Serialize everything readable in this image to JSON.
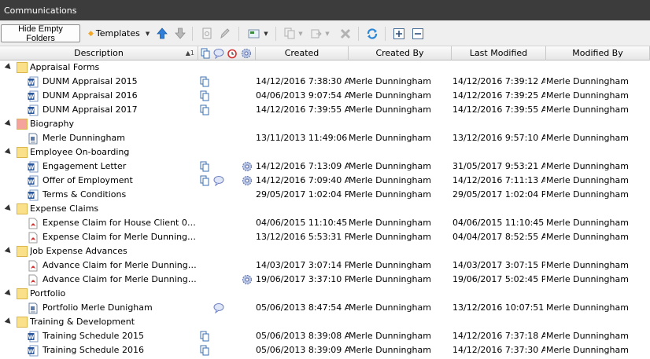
{
  "window": {
    "title": "Communications"
  },
  "toolbar": {
    "hide_empty_label": "Hide Empty Folders",
    "templates_label": "Templates",
    "icons": [
      "move-up-icon",
      "move-down-icon",
      "preview-icon",
      "edit-icon",
      "image-icon",
      "copy-icon",
      "export-icon",
      "delete-icon",
      "refresh-icon",
      "expand-all-icon",
      "collapse-all-icon"
    ]
  },
  "columns": {
    "description": "Description",
    "sort_indicator": "▲1",
    "created": "Created",
    "created_by": "Created By",
    "last_modified": "Last Modified",
    "modified_by": "Modified By"
  },
  "colors": {
    "titlebar": "#3c3c3c",
    "folder": "#fbe08a",
    "biography_folder": "#f4a49a",
    "word": "#2b579a",
    "pdf": "#d32f2f"
  },
  "groups": [
    {
      "name": "Appraisal Forms",
      "folder_color": "#fbe08a",
      "items": [
        {
          "type": "word",
          "name": "DUNM Appraisal 2015",
          "icons": [
            "copy"
          ],
          "created": "14/12/2016 7:38:30 AM",
          "created_by": "Merle Dunningham",
          "last_modified": "14/12/2016 7:39:12 AM",
          "modified_by": "Merle Dunningham"
        },
        {
          "type": "word",
          "name": "DUNM Appraisal 2016",
          "icons": [
            "copy"
          ],
          "created": "04/06/2013 9:07:54 AM",
          "created_by": "Merle Dunningham",
          "last_modified": "14/12/2016 7:39:25 AM",
          "modified_by": "Merle Dunningham"
        },
        {
          "type": "word",
          "name": "DUNM Appraisal 2017",
          "icons": [
            "copy"
          ],
          "created": "14/12/2016 7:39:55 AM",
          "created_by": "Merle Dunningham",
          "last_modified": "14/12/2016 7:39:55 AM",
          "modified_by": "Merle Dunningham"
        }
      ]
    },
    {
      "name": "Biography",
      "folder_color": "#f4a49a",
      "items": [
        {
          "type": "doc",
          "name": "Merle Dunningham",
          "icons": [],
          "created": "13/11/2013 11:49:06 ...",
          "created_by": "Merle Dunningham",
          "last_modified": "13/12/2016 9:57:10 AM",
          "modified_by": "Merle Dunningham"
        }
      ]
    },
    {
      "name": "Employee On-boarding",
      "folder_color": "#fbe08a",
      "items": [
        {
          "type": "word",
          "name": "Engagement Letter",
          "icons": [
            "copy",
            "gear"
          ],
          "created": "14/12/2016 7:13:09 AM",
          "created_by": "Merle Dunningham",
          "last_modified": "31/05/2017 9:53:21 AM",
          "modified_by": "Merle Dunningham"
        },
        {
          "type": "word",
          "name": "Offer of Employment",
          "icons": [
            "copy",
            "comment",
            "gear"
          ],
          "created": "14/12/2016 7:09:40 AM",
          "created_by": "Merle Dunningham",
          "last_modified": "14/12/2016 7:11:13 AM",
          "modified_by": "Merle Dunningham"
        },
        {
          "type": "word",
          "name": "Terms & Conditions",
          "icons": [],
          "created": "29/05/2017 1:02:04 PM",
          "created_by": "Merle Dunningham",
          "last_modified": "29/05/2017 1:02:04 PM",
          "modified_by": "Merle Dunningham"
        }
      ]
    },
    {
      "name": "Expense Claims",
      "folder_color": "#fbe08a",
      "items": [
        {
          "type": "pdf",
          "name": "Expense Claim for House Client 04/06/15",
          "icons": [],
          "created": "04/06/2015 11:10:45 ...",
          "created_by": "Merle Dunningham",
          "last_modified": "04/06/2015 11:10:45 ...",
          "modified_by": "Merle Dunningham"
        },
        {
          "type": "pdf",
          "name": "Expense Claim for Merle Dunningham ...",
          "icons": [],
          "created": "13/12/2016 5:53:31 PM",
          "created_by": "Merle Dunningham",
          "last_modified": "04/04/2017 8:52:55 AM",
          "modified_by": "Merle Dunningham"
        }
      ]
    },
    {
      "name": "Job Expense Advances",
      "folder_color": "#fbe08a",
      "items": [
        {
          "type": "pdf",
          "name": "Advance Claim for Merle Dunningham ...",
          "icons": [],
          "created": "14/03/2017 3:07:14 PM",
          "created_by": "Merle Dunningham",
          "last_modified": "14/03/2017 3:07:15 PM",
          "modified_by": "Merle Dunningham"
        },
        {
          "type": "pdf",
          "name": "Advance Claim for Merle Dunningham ...",
          "icons": [
            "gear"
          ],
          "created": "19/06/2017 3:37:10 PM",
          "created_by": "Merle Dunningham",
          "last_modified": "19/06/2017 5:02:45 PM",
          "modified_by": "Merle Dunningham"
        }
      ]
    },
    {
      "name": "Portfolio",
      "folder_color": "#fbe08a",
      "items": [
        {
          "type": "doc",
          "name": "Portfolio Merle Dunigham",
          "icons": [
            "comment"
          ],
          "created": "05/06/2013 8:47:54 AM",
          "created_by": "Merle Dunningham",
          "last_modified": "13/12/2016 10:07:51 ...",
          "modified_by": "Merle Dunningham"
        }
      ]
    },
    {
      "name": "Training & Development",
      "folder_color": "#fbe08a",
      "items": [
        {
          "type": "word",
          "name": "Training Schedule 2015",
          "icons": [
            "copy"
          ],
          "created": "05/06/2013 8:39:08 AM",
          "created_by": "Merle Dunningham",
          "last_modified": "14/12/2016 7:37:18 AM",
          "modified_by": "Merle Dunningham"
        },
        {
          "type": "word",
          "name": "Training Schedule 2016",
          "icons": [
            "copy"
          ],
          "created": "05/06/2013 8:39:09 AM",
          "created_by": "Merle Dunningham",
          "last_modified": "14/12/2016 7:37:30 AM",
          "modified_by": "Merle Dunningham"
        }
      ]
    }
  ]
}
